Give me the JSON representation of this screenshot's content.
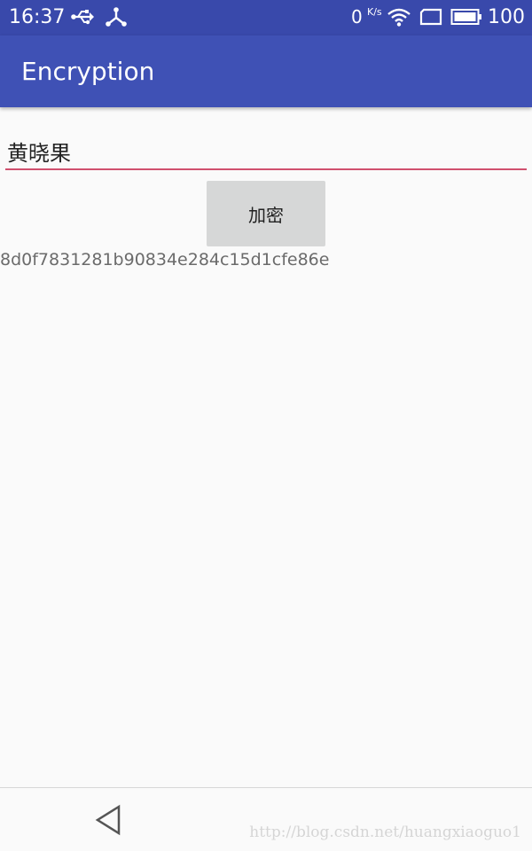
{
  "status_bar": {
    "time": "16:37",
    "network_speed": "0",
    "network_speed_unit": "K/s",
    "battery_level": "100",
    "icons": [
      "usb-icon",
      "share-icon",
      "wifi-icon",
      "sim-icon",
      "battery-icon"
    ]
  },
  "app_bar": {
    "title": "Encryption"
  },
  "form": {
    "input_value": "黄晓果",
    "button_label": "加密",
    "result": "8d0f7831281b90834e284c15d1cfe86e"
  },
  "navigation": {
    "back_icon": "back-triangle-icon"
  },
  "watermark": "http://blog.csdn.net/huangxiaoguo1",
  "colors": {
    "status_bar": "#3949ab",
    "app_bar": "#3f51b5",
    "input_underline": "#d0506e",
    "button_background": "#d6d7d7",
    "page_background": "#fafafa"
  }
}
